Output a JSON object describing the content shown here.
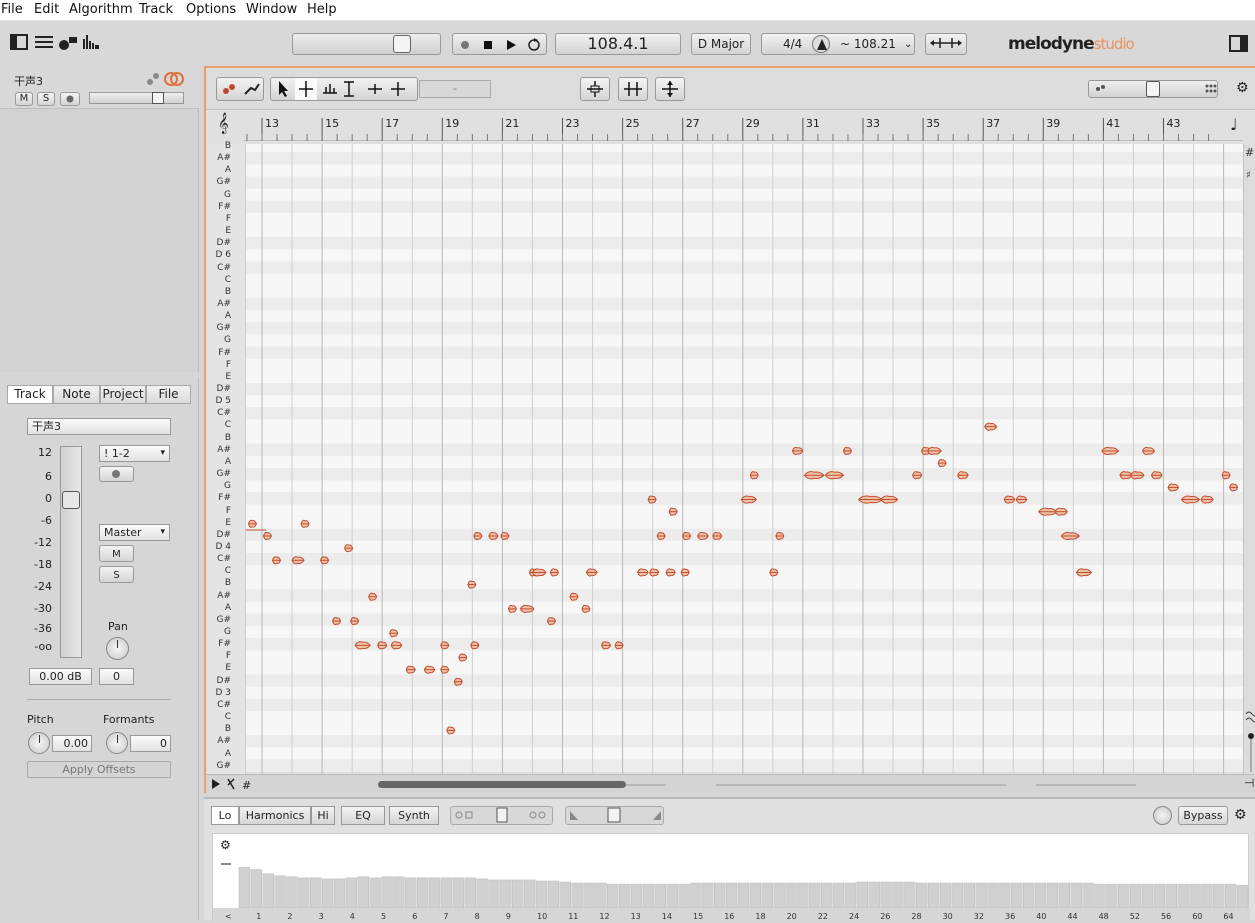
{
  "menu": [
    "File",
    "Edit",
    "Algorithm",
    "Track",
    "Options",
    "Window",
    "Help"
  ],
  "transport": {
    "position": "108.4.1",
    "key": "D Major",
    "meter": "4/4",
    "tempo": "~ 108.21"
  },
  "brand": {
    "name": "melodyne",
    "edition": "studio"
  },
  "track_list": {
    "name": "干声3",
    "mute": "M",
    "solo": "S"
  },
  "inspector": {
    "tabs": [
      "Track",
      "Note",
      "Project",
      "File"
    ],
    "track_name": "干声3",
    "input": "! 1-2",
    "output": "Master",
    "mute": "M",
    "solo": "S",
    "fader_scale": [
      "12",
      "6",
      "0",
      "-6",
      "-12",
      "-18",
      "-24",
      "-30",
      "-36",
      "-oo"
    ],
    "volume": "0.00 dB",
    "pan_label": "Pan",
    "pan_value": "0",
    "pitch_label": "Pitch",
    "pitch_value": "0.00",
    "formants_label": "Formants",
    "formants_value": "0",
    "apply_label": "Apply Offsets"
  },
  "editor": {
    "field": "-",
    "bars": [
      "13",
      "15",
      "17",
      "19",
      "21",
      "23",
      "25",
      "27",
      "29",
      "31",
      "33",
      "35",
      "37",
      "39",
      "41",
      "43"
    ],
    "pitches": [
      "B",
      "A#",
      "A",
      "G#",
      "G",
      "F#",
      "F",
      "E",
      "D#",
      "D 6",
      "C#",
      "C",
      "B",
      "A#",
      "A",
      "G#",
      "G",
      "F#",
      "F",
      "E",
      "D#",
      "D 5",
      "C#",
      "C",
      "B",
      "A#",
      "A",
      "G#",
      "G",
      "F#",
      "F",
      "E",
      "D#",
      "D 4",
      "C#",
      "C",
      "B",
      "A#",
      "A",
      "G#",
      "G",
      "F#",
      "F",
      "E",
      "D#",
      "D 3",
      "C#",
      "C",
      "B",
      "A#",
      "A",
      "G#"
    ]
  },
  "notes": [
    {
      "bar": 12.55,
      "len": 0.15,
      "p": 20.0
    },
    {
      "bar": 13.05,
      "len": 0.25,
      "p": 19.0
    },
    {
      "bar": 13.35,
      "len": 0.25,
      "p": 17.0
    },
    {
      "bar": 14.3,
      "len": 0.15,
      "p": 20.0
    },
    {
      "bar": 14.0,
      "len": 0.4,
      "p": 17.0
    },
    {
      "bar": 14.95,
      "len": 0.25,
      "p": 17.0
    },
    {
      "bar": 15.35,
      "len": 0.2,
      "p": 12.0
    },
    {
      "bar": 15.75,
      "len": 0.15,
      "p": 18.0
    },
    {
      "bar": 15.95,
      "len": 0.1,
      "p": 12.0
    },
    {
      "bar": 16.1,
      "len": 0.5,
      "p": 10.0
    },
    {
      "bar": 16.85,
      "len": 0.3,
      "p": 10.0
    },
    {
      "bar": 17.3,
      "len": 0.35,
      "p": 10.0
    },
    {
      "bar": 16.55,
      "len": 0.15,
      "p": 14.0
    },
    {
      "bar": 17.25,
      "len": 0.12,
      "p": 11.0
    },
    {
      "bar": 17.8,
      "len": 0.3,
      "p": 8.0
    },
    {
      "bar": 18.4,
      "len": 0.35,
      "p": 8.0
    },
    {
      "bar": 18.95,
      "len": 0.25,
      "p": 8.0
    },
    {
      "bar": 18.95,
      "len": 0.25,
      "p": 10.0
    },
    {
      "bar": 19.15,
      "len": 0.2,
      "p": 3.0
    },
    {
      "bar": 19.4,
      "len": 0.1,
      "p": 7.0
    },
    {
      "bar": 19.55,
      "len": 0.15,
      "p": 9.0
    },
    {
      "bar": 19.95,
      "len": 0.1,
      "p": 10.0
    },
    {
      "bar": 19.85,
      "len": 0.2,
      "p": 15.0
    },
    {
      "bar": 20.05,
      "len": 0.15,
      "p": 19.0
    },
    {
      "bar": 20.55,
      "len": 0.3,
      "p": 19.0
    },
    {
      "bar": 20.95,
      "len": 0.25,
      "p": 19.0
    },
    {
      "bar": 21.2,
      "len": 0.2,
      "p": 13.0
    },
    {
      "bar": 21.6,
      "len": 0.45,
      "p": 13.0
    },
    {
      "bar": 21.9,
      "len": 0.1,
      "p": 16.0
    },
    {
      "bar": 22.0,
      "len": 0.45,
      "p": 16.0
    },
    {
      "bar": 22.6,
      "len": 0.2,
      "p": 16.0
    },
    {
      "bar": 22.5,
      "len": 0.25,
      "p": 12.0
    },
    {
      "bar": 23.25,
      "len": 0.2,
      "p": 14.0
    },
    {
      "bar": 23.8,
      "len": 0.35,
      "p": 16.0
    },
    {
      "bar": 23.65,
      "len": 0.25,
      "p": 13.0
    },
    {
      "bar": 24.3,
      "len": 0.3,
      "p": 10.0
    },
    {
      "bar": 24.75,
      "len": 0.25,
      "p": 10.0
    },
    {
      "bar": 25.5,
      "len": 0.35,
      "p": 16.0
    },
    {
      "bar": 25.9,
      "len": 0.3,
      "p": 16.0
    },
    {
      "bar": 26.15,
      "len": 0.2,
      "p": 19.0
    },
    {
      "bar": 26.45,
      "len": 0.3,
      "p": 16.0
    },
    {
      "bar": 26.95,
      "len": 0.25,
      "p": 16.0
    },
    {
      "bar": 27.0,
      "len": 0.25,
      "p": 19.0
    },
    {
      "bar": 27.5,
      "len": 0.35,
      "p": 19.0
    },
    {
      "bar": 28.0,
      "len": 0.3,
      "p": 19.0
    },
    {
      "bar": 25.85,
      "len": 0.15,
      "p": 22.0
    },
    {
      "bar": 26.55,
      "len": 0.1,
      "p": 21.0
    },
    {
      "bar": 28.95,
      "len": 0.5,
      "p": 22.0
    },
    {
      "bar": 29.25,
      "len": 0.15,
      "p": 24.0
    },
    {
      "bar": 29.9,
      "len": 0.25,
      "p": 16.0
    },
    {
      "bar": 30.1,
      "len": 0.15,
      "p": 19.0
    },
    {
      "bar": 30.65,
      "len": 0.35,
      "p": 26.0
    },
    {
      "bar": 31.05,
      "len": 0.65,
      "p": 24.0
    },
    {
      "bar": 31.75,
      "len": 0.6,
      "p": 24.0
    },
    {
      "bar": 32.35,
      "len": 0.25,
      "p": 26.0
    },
    {
      "bar": 32.85,
      "len": 0.8,
      "p": 22.0
    },
    {
      "bar": 33.6,
      "len": 0.55,
      "p": 22.0
    },
    {
      "bar": 34.65,
      "len": 0.3,
      "p": 24.0
    },
    {
      "bar": 34.95,
      "len": 0.3,
      "p": 26.0
    },
    {
      "bar": 35.15,
      "len": 0.45,
      "p": 26.0
    },
    {
      "bar": 35.5,
      "len": 0.15,
      "p": 25.0
    },
    {
      "bar": 36.15,
      "len": 0.35,
      "p": 24.0
    },
    {
      "bar": 37.05,
      "len": 0.4,
      "p": 28.0
    },
    {
      "bar": 37.7,
      "len": 0.35,
      "p": 22.0
    },
    {
      "bar": 38.1,
      "len": 0.35,
      "p": 22.0
    },
    {
      "bar": 38.85,
      "len": 0.6,
      "p": 21.0
    },
    {
      "bar": 39.4,
      "len": 0.4,
      "p": 21.0
    },
    {
      "bar": 39.6,
      "len": 0.6,
      "p": 19.0
    },
    {
      "bar": 40.1,
      "len": 0.5,
      "p": 16.0
    },
    {
      "bar": 40.95,
      "len": 0.55,
      "p": 26.0
    },
    {
      "bar": 41.55,
      "len": 0.4,
      "p": 24.0
    },
    {
      "bar": 41.9,
      "len": 0.45,
      "p": 24.0
    },
    {
      "bar": 42.3,
      "len": 0.4,
      "p": 26.0
    },
    {
      "bar": 42.6,
      "len": 0.35,
      "p": 24.0
    },
    {
      "bar": 43.15,
      "len": 0.35,
      "p": 23.0
    },
    {
      "bar": 43.6,
      "len": 0.6,
      "p": 22.0
    },
    {
      "bar": 44.25,
      "len": 0.4,
      "p": 22.0
    },
    {
      "bar": 44.95,
      "len": 0.25,
      "p": 24.0
    },
    {
      "bar": 45.2,
      "len": 0.2,
      "p": 23.0
    }
  ],
  "lower_panel": {
    "tabs": [
      "Lo",
      "Harmonics",
      "Hi",
      "EQ",
      "Synth"
    ],
    "bypass": "Bypass",
    "harmonics": [
      "<",
      "1",
      "2",
      "3",
      "4",
      "5",
      "6",
      "7",
      "8",
      "9",
      "10",
      "11",
      "12",
      "13",
      "14",
      "15",
      "16",
      "18",
      "20",
      "22",
      "24",
      "26",
      "28",
      "30",
      "32",
      "36",
      "40",
      "44",
      "48",
      "52",
      "56",
      "60",
      "64"
    ],
    "levels": [
      0.78,
      0.74,
      0.66,
      0.62,
      0.6,
      0.58,
      0.58,
      0.56,
      0.56,
      0.58,
      0.6,
      0.58,
      0.6,
      0.6,
      0.58,
      0.58,
      0.58,
      0.58,
      0.58,
      0.58,
      0.56,
      0.54,
      0.54,
      0.54,
      0.54,
      0.52,
      0.52,
      0.5,
      0.48,
      0.48,
      0.48,
      0.46,
      0.46,
      0.46,
      0.46,
      0.46,
      0.46,
      0.46,
      0.48,
      0.48,
      0.48,
      0.48,
      0.48,
      0.48,
      0.48,
      0.48,
      0.48,
      0.48,
      0.48,
      0.48,
      0.48,
      0.48,
      0.5,
      0.5,
      0.5,
      0.5,
      0.5,
      0.48,
      0.48,
      0.48,
      0.48,
      0.48,
      0.48,
      0.48,
      0.48,
      0.48,
      0.48,
      0.48,
      0.48,
      0.48,
      0.48,
      0.48,
      0.46,
      0.46,
      0.46,
      0.46,
      0.46,
      0.46,
      0.46,
      0.46,
      0.46,
      0.46,
      0.46,
      0.46,
      0.44
    ]
  },
  "colors": {
    "note_fill": "#f2c0a8",
    "note_stroke": "#c05030",
    "accent": "#e8a070"
  }
}
